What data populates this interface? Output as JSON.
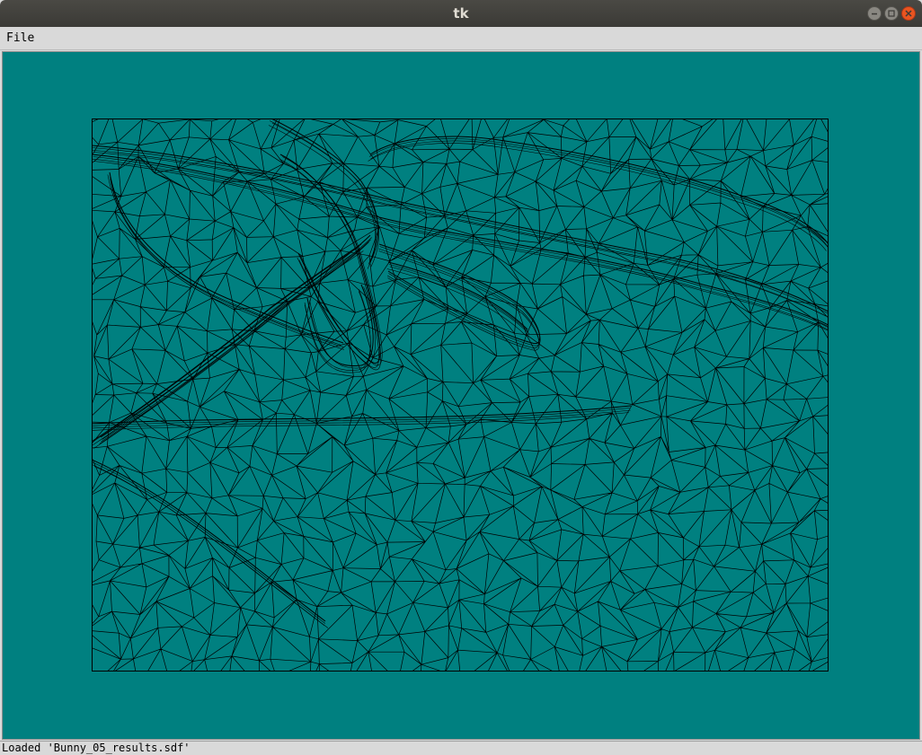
{
  "window": {
    "title": "tk"
  },
  "menubar": {
    "file_label": "File"
  },
  "canvas": {
    "background": "#008080",
    "wire_color": "#000000"
  },
  "status": {
    "text": "Loaded 'Bunny_05_results.sdf'"
  }
}
